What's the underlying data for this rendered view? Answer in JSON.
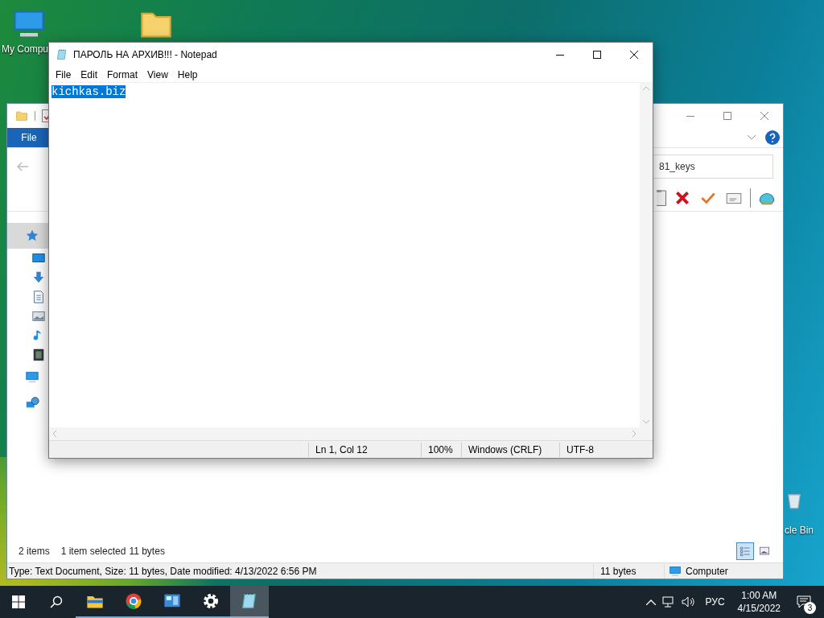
{
  "desktop": {
    "icons": [
      {
        "kind": "computer",
        "label": "My Compu"
      },
      {
        "kind": "folder"
      },
      {
        "kind": "bin",
        "label": "cle Bin"
      }
    ]
  },
  "explorer": {
    "file_tab": "File",
    "address": "81_keys",
    "toolbar": [
      {
        "kind": "clipboard"
      },
      {
        "kind": "delete"
      },
      {
        "kind": "check"
      },
      {
        "kind": "envelope"
      },
      {
        "kind": "shell"
      }
    ],
    "nav_items": [
      {
        "kind": "star",
        "selected": true
      },
      {
        "kind": "desktop",
        "selected": false
      },
      {
        "kind": "download",
        "selected": false
      },
      {
        "kind": "document",
        "selected": false
      },
      {
        "kind": "image",
        "selected": false
      },
      {
        "kind": "music",
        "selected": false
      },
      {
        "kind": "video",
        "selected": false
      },
      {
        "kind": "computer",
        "selected": false
      },
      {
        "kind": "network",
        "selected": false
      }
    ],
    "status": {
      "count": "2 items",
      "selected": "1 item selected",
      "size": "11 bytes"
    },
    "views": [
      {
        "kind": "details",
        "selected": true
      },
      {
        "kind": "tiles",
        "selected": false
      }
    ],
    "details_bar": {
      "text": "Type: Text Document, Size: 11 bytes, Date modified: 4/13/2022 6:56 PM",
      "size": "11 bytes",
      "location": "Computer"
    }
  },
  "notepad": {
    "title": "ПАРОЛЬ НА АРХИВ!!! - Notepad",
    "menu": [
      "File",
      "Edit",
      "Format",
      "View",
      "Help"
    ],
    "text": "kichkas.biz",
    "text_selected": true,
    "status": [
      "Ln 1, Col 12",
      "100%",
      "Windows (CRLF)",
      "UTF-8"
    ]
  },
  "taskbar": {
    "apps": [
      {
        "kind": "explorer",
        "selected": false
      },
      {
        "kind": "chrome",
        "selected": false
      },
      {
        "kind": "control",
        "selected": false
      },
      {
        "kind": "settings",
        "selected": false
      },
      {
        "kind": "notepad",
        "selected": true
      }
    ],
    "language": "РУС",
    "time": "1:00 AM",
    "date": "4/15/2022",
    "notifications": "3"
  }
}
